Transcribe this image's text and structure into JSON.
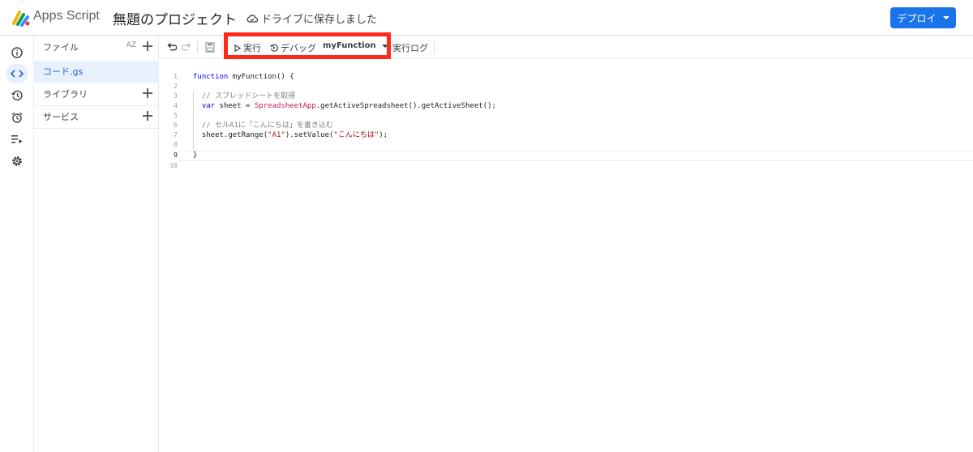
{
  "header": {
    "app_name": "Apps Script",
    "project_title": "無題のプロジェクト",
    "save_status": "ドライブに保存しました",
    "deploy_label": "デプロイ"
  },
  "rail": {
    "icons": [
      "info-icon",
      "code-icon",
      "history-icon",
      "trigger-alarm-icon",
      "executions-icon",
      "settings-icon"
    ]
  },
  "filepanel": {
    "files_label": "ファイル",
    "sort_label": "AZ",
    "files": [
      "コード.gs"
    ],
    "libraries_label": "ライブラリ",
    "services_label": "サービス"
  },
  "toolbar": {
    "run_label": "実行",
    "debug_label": "デバッグ",
    "function_name": "myFunction",
    "log_label": "実行ログ"
  },
  "editor": {
    "line_numbers": [
      "1",
      "2",
      "3",
      "4",
      "5",
      "6",
      "7",
      "8",
      "9",
      "10"
    ],
    "current_line": 9
  },
  "colors": {
    "accent": "#1a73e8",
    "highlight_box": "#ff2a1a",
    "selected_file_bg": "#e8f0fe"
  }
}
